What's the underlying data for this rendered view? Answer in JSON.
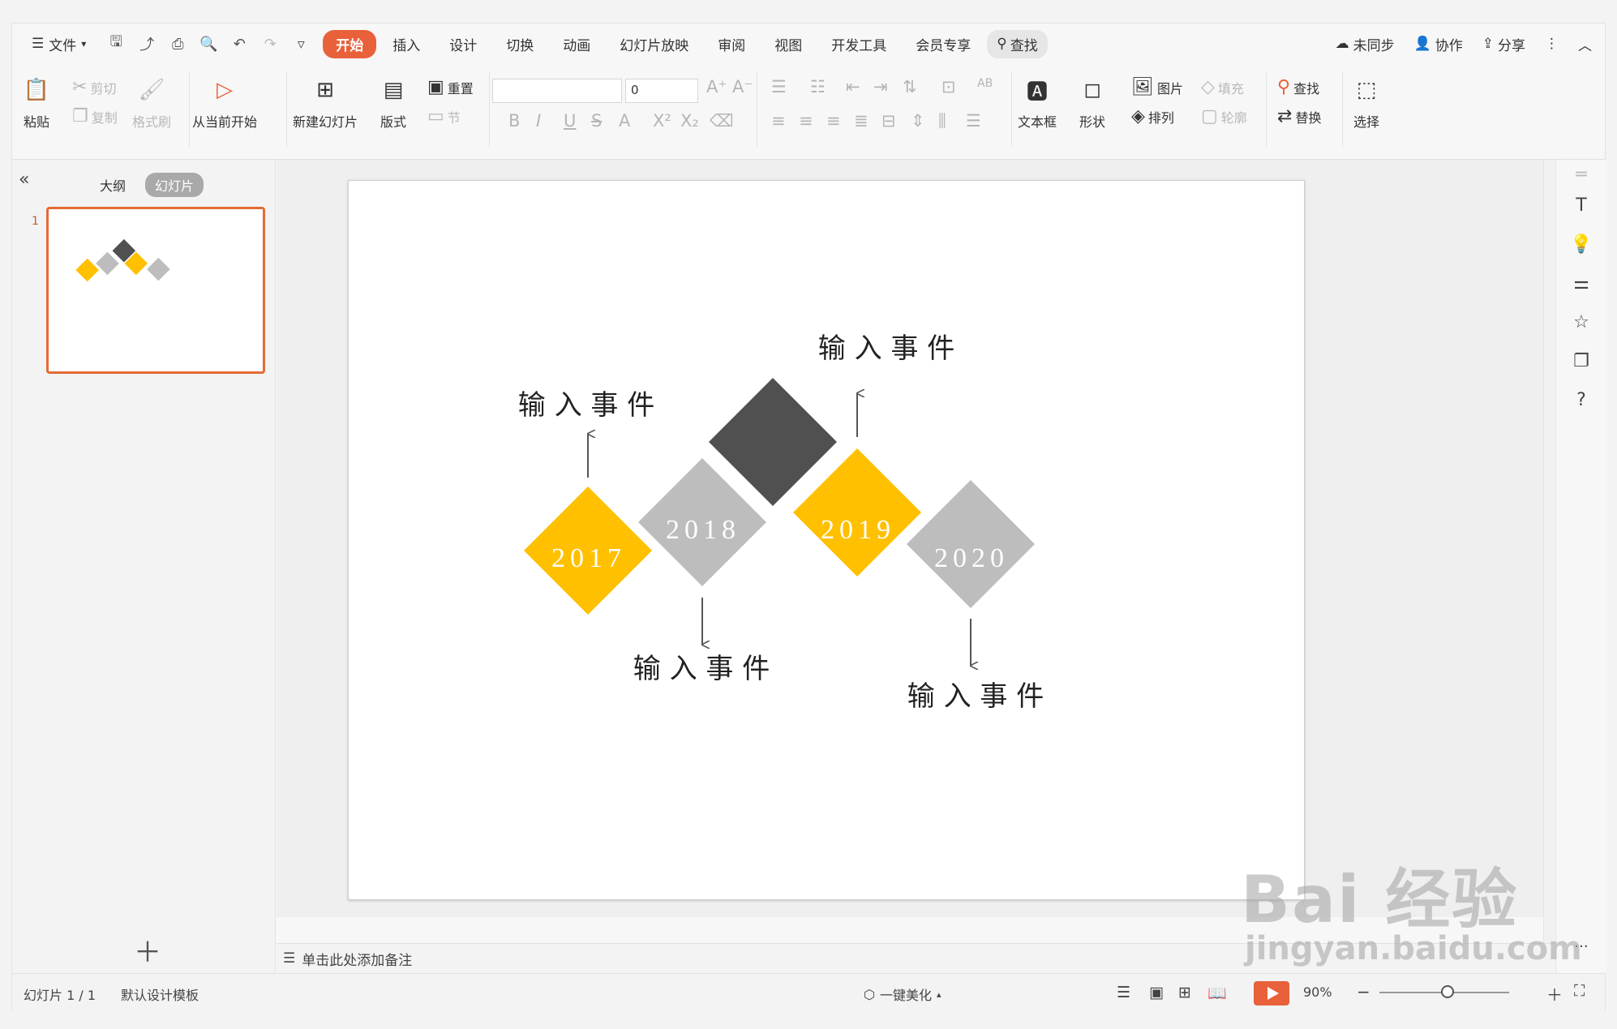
{
  "menubar": {
    "file_label": "文件",
    "tabs": [
      "开始",
      "插入",
      "设计",
      "切换",
      "动画",
      "幻灯片放映",
      "审阅",
      "视图",
      "开发工具",
      "会员专享"
    ],
    "search_label": "查找",
    "right": {
      "sync": "未同步",
      "collab": "协作",
      "share": "分享"
    }
  },
  "ribbon": {
    "paste": "粘贴",
    "cut": "剪切",
    "copy": "复制",
    "format_painter": "格式刷",
    "from_current": "从当前开始",
    "new_slide": "新建幻灯片",
    "layout": "版式",
    "reset": "重置",
    "section": "节",
    "font_size": "0",
    "textbox": "文本框",
    "shape": "形状",
    "picture": "图片",
    "fill": "填充",
    "arrange": "排列",
    "outline": "轮廓",
    "find": "查找",
    "replace": "替换",
    "select": "选择"
  },
  "leftpanel": {
    "outline_tab": "大纲",
    "slides_tab": "幻灯片",
    "slide_number": "1"
  },
  "slide": {
    "items": [
      {
        "year": "2017",
        "label": "输 入 事 件"
      },
      {
        "year": "2018",
        "label": "输 入 事 件"
      },
      {
        "year": "2019",
        "label": "输 入 事 件"
      },
      {
        "year": "2020",
        "label": "输 入 事 件"
      }
    ],
    "colors": {
      "yellow": "#ffc000",
      "gray": "#bdbdbd",
      "dark": "#505050"
    }
  },
  "notes": {
    "placeholder": "单击此处添加备注"
  },
  "statusbar": {
    "slide_count": "幻灯片 1 / 1",
    "template": "默认设计模板",
    "beautify": "一键美化",
    "zoom": "90%"
  },
  "watermark": {
    "brand": "Bai 经验",
    "site": "jingyan.baidu.com"
  }
}
